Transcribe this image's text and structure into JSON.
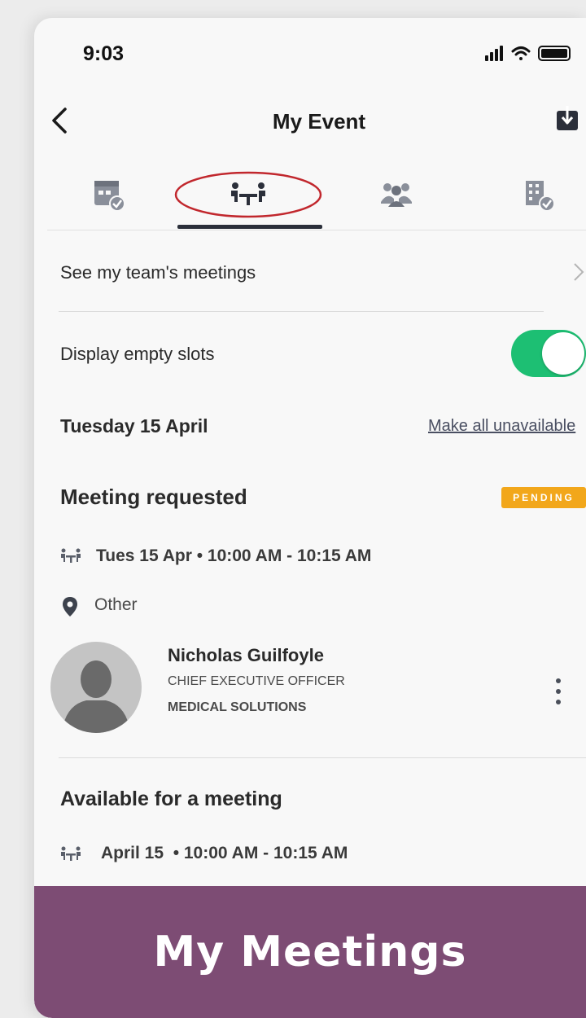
{
  "status_bar": {
    "time": "9:03"
  },
  "header": {
    "title": "My Event"
  },
  "tabs": [
    {
      "icon": "calendar-check-icon",
      "active": false
    },
    {
      "icon": "meeting-table-icon",
      "active": true
    },
    {
      "icon": "people-group-icon",
      "active": false
    },
    {
      "icon": "building-check-icon",
      "active": false
    }
  ],
  "team_meetings_label": "See my team's meetings",
  "empty_slots": {
    "label": "Display empty slots",
    "enabled": true
  },
  "day": {
    "date_label": "Tuesday 15 April",
    "action_label": "Make all unavailable"
  },
  "meeting_requested": {
    "title": "Meeting requested",
    "status": "PENDING",
    "time_label": "Tues 15 Apr • 10:00 AM - 10:15 AM",
    "location": "Other",
    "person": {
      "name": "Nicholas Guilfoyle",
      "job_title": "CHIEF EXECUTIVE OFFICER",
      "company": "MEDICAL SOLUTIONS"
    }
  },
  "available": {
    "title": "Available for a meeting",
    "time_label": "April 15  • 10:00 AM - 10:15 AM"
  },
  "banner": {
    "text": "My Meetings"
  },
  "colors": {
    "toggle_on": "#1dbf73",
    "badge": "#f2a71b",
    "banner": "#7d4c74",
    "tab_indicator": "#2b2f3a",
    "annotation": "#c1272d"
  }
}
